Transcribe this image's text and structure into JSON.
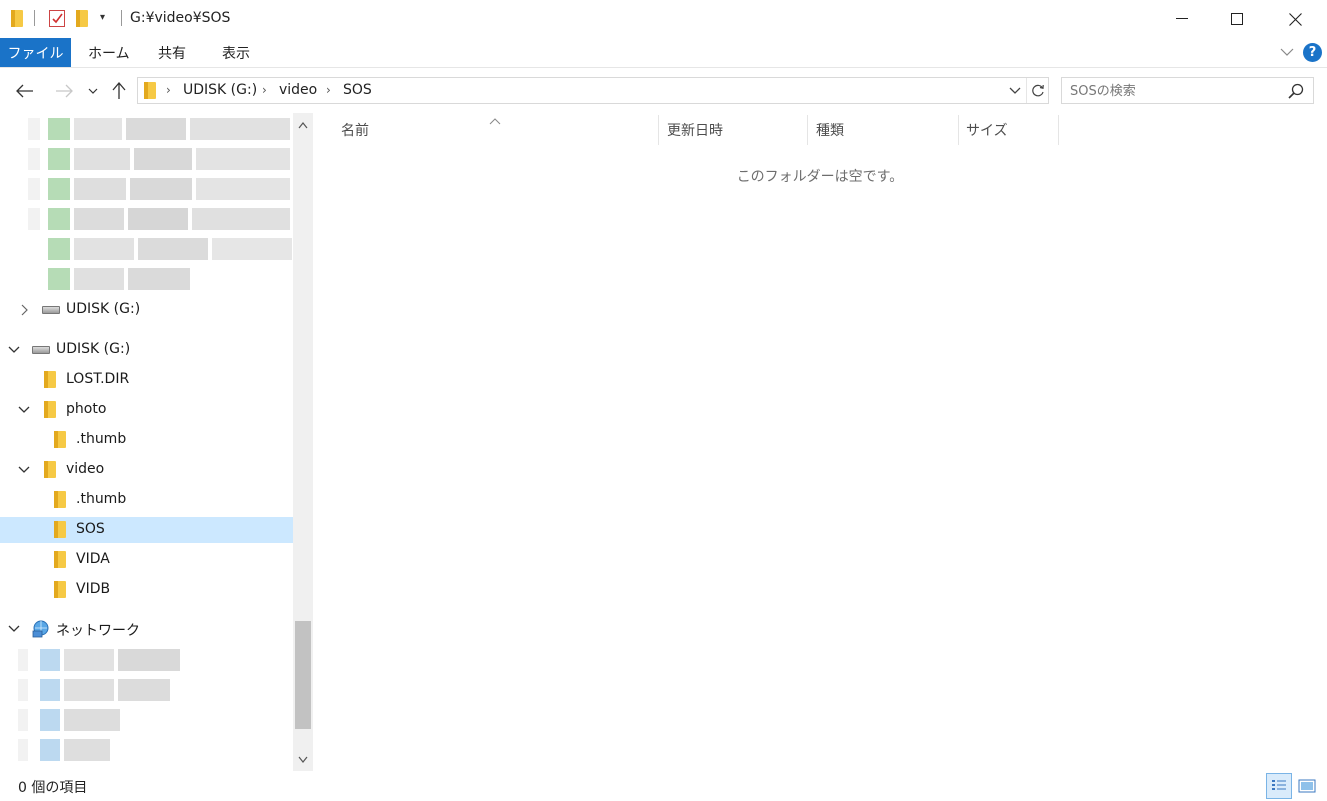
{
  "window": {
    "title": "G:¥video¥SOS",
    "minimize_label": "—",
    "maximize_label": "□",
    "close_label": "×"
  },
  "ribbon": {
    "tabs": [
      "ファイル",
      "ホーム",
      "共有",
      "表示"
    ],
    "help_label": "?"
  },
  "address_bar": {
    "breadcrumbs": [
      "UDISK (G:)",
      "video",
      "SOS"
    ]
  },
  "search": {
    "placeholder": "SOSの検索"
  },
  "nav_pane": {
    "drive_collapsed": "UDISK (G:)",
    "drive_expanded": "UDISK (G:)",
    "folders": {
      "lost_dir": "LOST.DIR",
      "photo": "photo",
      "photo_thumb": ".thumb",
      "video": "video",
      "video_thumb": ".thumb",
      "sos": "SOS",
      "vida": "VIDA",
      "vidb": "VIDB"
    },
    "network": "ネットワーク"
  },
  "columns": [
    "名前",
    "更新日時",
    "種類",
    "サイズ"
  ],
  "empty_message": "このフォルダーは空です。",
  "status": {
    "item_count": "0 個の項目"
  },
  "colors": {
    "accent": "#1a73c8",
    "selection": "#cce8ff",
    "folder": "#f6c945"
  }
}
